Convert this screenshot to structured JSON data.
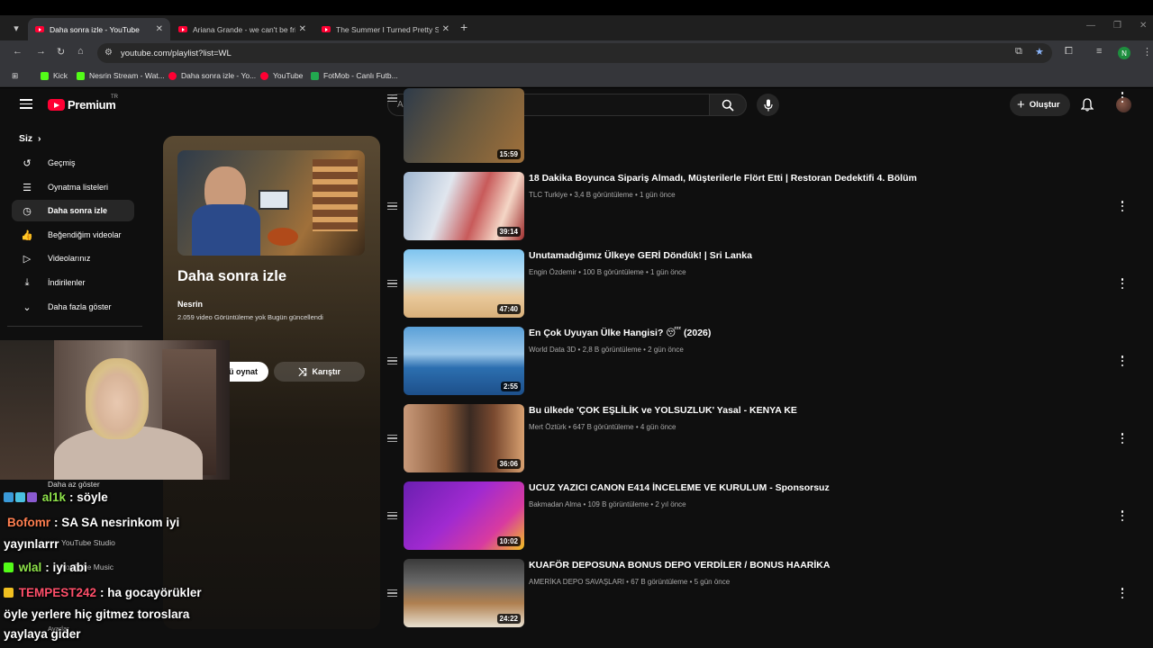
{
  "browser": {
    "tabs": [
      {
        "title": "Daha sonra izle - YouTube",
        "active": true
      },
      {
        "title": "Ariana Grande - we can't be frie",
        "active": false
      },
      {
        "title": "The Summer I Turned Pretty S3",
        "active": false
      }
    ],
    "url": "youtube.com/playlist?list=WL",
    "profile_initial": "N",
    "bookmarks": [
      "Kick",
      "Nesrin Stream - Wat...",
      "Daha sonra izle - Yo...",
      "YouTube",
      "FotMob - Canlı Futb..."
    ]
  },
  "youtube": {
    "logo_text": "Premium",
    "logo_region": "TR",
    "search_placeholder": "Ara",
    "create_label": "Oluştur",
    "sidebar": {
      "section": "Siz",
      "items": [
        {
          "label": "Geçmiş",
          "icon": "history-icon"
        },
        {
          "label": "Oynatma listeleri",
          "icon": "playlists-icon"
        },
        {
          "label": "Daha sonra izle",
          "icon": "watch-later-icon"
        },
        {
          "label": "Beğendiğim videolar",
          "icon": "thumbs-up-icon"
        },
        {
          "label": "Videolarınız",
          "icon": "your-videos-icon"
        },
        {
          "label": "İndirilenler",
          "icon": "download-icon"
        },
        {
          "label": "Daha fazla göster",
          "icon": "chevron-down-icon"
        }
      ],
      "show_less": "Daha az göster",
      "studio": "YouTube Studio",
      "music": "YouTube Music",
      "settings": "Ayarlar"
    },
    "playlist": {
      "title": "Daha sonra izle",
      "owner": "Nesrin",
      "meta": "2.059 video   Görüntüleme yok   Bugün güncellendi",
      "play_all": "ü oynat",
      "shuffle": "Karıştır"
    },
    "videos": [
      {
        "title": "",
        "meta": "",
        "duration": "15:59"
      },
      {
        "title": "18 Dakika Boyunca Sipariş Almadı, Müşterilerle Flört Etti | Restoran Dedektifi 4. Bölüm",
        "meta": "TLC Turkiye • 3,4 B görüntüleme • 1 gün önce",
        "duration": "39:14"
      },
      {
        "title": "Unutamadığımız Ülkeye GERİ Döndük! | Sri Lanka",
        "meta": "Engin Özdemir • 100 B görüntüleme • 1 gün önce",
        "duration": "47:40"
      },
      {
        "title": "En Çok Uyuyan Ülke Hangisi? 😴 (2026)",
        "meta": "World Data 3D • 2,8 B görüntüleme • 2 gün önce",
        "duration": "2:55"
      },
      {
        "title": "Bu ülkede 'ÇOK EŞLİLİK ve YOLSUZLUK' Yasal - KENYA KE",
        "meta": "Mert Öztürk • 647 B görüntüleme • 4 gün önce",
        "duration": "36:06"
      },
      {
        "title": "UCUZ YAZICI CANON E414 İNCELEME VE KURULUM - Sponsorsuz",
        "meta": "Bakmadan Alma • 109 B görüntüleme • 2 yıl önce",
        "duration": "10:02"
      },
      {
        "title": "KUAFÖR DEPOSUNA BONUS DEPO VERDİLER / BONUS HAARİKA",
        "meta": "AMERİKA DEPO SAVAŞLARI • 67 B görüntüleme • 5 gün önce",
        "duration": "24:22"
      }
    ]
  },
  "stream_chat": [
    {
      "user": "al1k",
      "text": ": söyle",
      "color": "#8ee24a"
    },
    {
      "user": "Bofomr",
      "text": ": SA SA nesrinkom iyi",
      "color": "#ff7f50"
    },
    {
      "user": "",
      "text": "yayınlarrr",
      "color": "#ffffff"
    },
    {
      "user": "wlal",
      "text": ": iyi abi",
      "color": "#8ee24a"
    },
    {
      "user": "TEMPEST242",
      "text": ": ha gocayörükler",
      "color": "#ff4f6a"
    },
    {
      "user": "",
      "text": "öyle yerlere hiç gitmez toroslara",
      "color": "#ffffff"
    },
    {
      "user": "",
      "text": "yaylaya gider",
      "color": "#ffffff"
    }
  ],
  "colors": {
    "yt_red": "#ff0033",
    "bg": "#0f0f0f"
  }
}
